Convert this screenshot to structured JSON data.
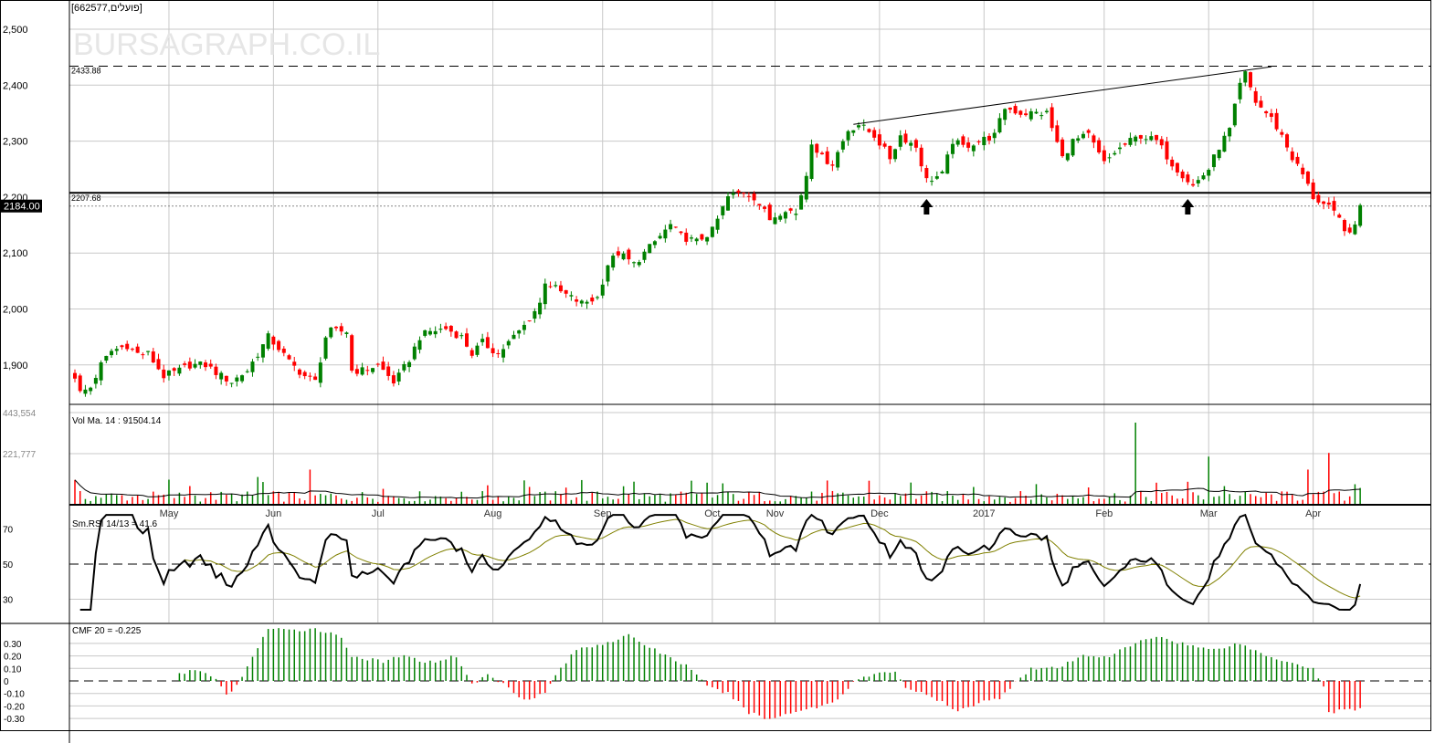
{
  "header": {
    "symbol_label": "[662577,פועלים]",
    "watermark": "BURSAGRAPH.CO.IL"
  },
  "colors": {
    "up": "#008000",
    "down": "#ff0000",
    "grid": "#c8c8c8",
    "signal": "#808000",
    "rsi": "#000000"
  },
  "chart_data": [
    {
      "type": "candlestick",
      "title": "[662577,פועלים]",
      "ylim": [
        1830,
        2550
      ],
      "yticks": [
        1900,
        2000,
        2100,
        2200,
        2300,
        2400,
        2500
      ],
      "ytick_labels": [
        "1,900",
        "2,000",
        "2,100",
        "2,200",
        "2,300",
        "2,400",
        "2,500"
      ],
      "x_months": [
        {
          "label": "May",
          "day": 18
        },
        {
          "label": "Jun",
          "day": 38
        },
        {
          "label": "Jul",
          "day": 58
        },
        {
          "label": "Aug",
          "day": 80
        },
        {
          "label": "Sep",
          "day": 101
        },
        {
          "label": "Oct",
          "day": 122
        },
        {
          "label": "Nov",
          "day": 134
        },
        {
          "label": "Dec",
          "day": 154
        },
        {
          "label": "2017",
          "day": 174
        },
        {
          "label": "Feb",
          "day": 197
        },
        {
          "label": "Mar",
          "day": 217
        },
        {
          "label": "Apr",
          "day": 237
        }
      ],
      "total_days": 247,
      "close_path": [
        [
          0,
          1880
        ],
        [
          1,
          1850
        ],
        [
          3,
          1860
        ],
        [
          5,
          1900
        ],
        [
          7,
          1925
        ],
        [
          10,
          1935
        ],
        [
          12,
          1920
        ],
        [
          14,
          1920
        ],
        [
          17,
          1880
        ],
        [
          20,
          1890
        ],
        [
          22,
          1900
        ],
        [
          25,
          1900
        ],
        [
          28,
          1880
        ],
        [
          30,
          1870
        ],
        [
          33,
          1890
        ],
        [
          35,
          1920
        ],
        [
          37,
          1950
        ],
        [
          39,
          1930
        ],
        [
          41,
          1905
        ],
        [
          44,
          1880
        ],
        [
          46,
          1870
        ],
        [
          48,
          1950
        ],
        [
          49,
          1960
        ],
        [
          52,
          1960
        ],
        [
          53,
          1890
        ],
        [
          55,
          1890
        ],
        [
          58,
          1900
        ],
        [
          61,
          1870
        ],
        [
          62,
          1880
        ],
        [
          64,
          1910
        ],
        [
          66,
          1950
        ],
        [
          68,
          1960
        ],
        [
          71,
          1965
        ],
        [
          74,
          1950
        ],
        [
          76,
          1920
        ],
        [
          78,
          1940
        ],
        [
          81,
          1920
        ],
        [
          83,
          1940
        ],
        [
          86,
          1970
        ],
        [
          89,
          2010
        ],
        [
          90,
          2050
        ],
        [
          93,
          2030
        ],
        [
          95,
          2020
        ],
        [
          97,
          2010
        ],
        [
          100,
          2020
        ],
        [
          102,
          2080
        ],
        [
          104,
          2100
        ],
        [
          107,
          2080
        ],
        [
          109,
          2100
        ],
        [
          112,
          2130
        ],
        [
          114,
          2150
        ],
        [
          116,
          2130
        ],
        [
          119,
          2120
        ],
        [
          122,
          2140
        ],
        [
          123,
          2160
        ],
        [
          125,
          2200
        ],
        [
          128,
          2210
        ],
        [
          130,
          2200
        ],
        [
          133,
          2160
        ],
        [
          136,
          2180
        ],
        [
          138,
          2170
        ],
        [
          140,
          2240
        ],
        [
          141,
          2300
        ],
        [
          143,
          2270
        ],
        [
          145,
          2260
        ],
        [
          148,
          2320
        ],
        [
          150,
          2330
        ],
        [
          153,
          2310
        ],
        [
          156,
          2270
        ],
        [
          158,
          2310
        ],
        [
          161,
          2290
        ],
        [
          163,
          2230
        ],
        [
          166,
          2240
        ],
        [
          168,
          2300
        ],
        [
          170,
          2290
        ],
        [
          173,
          2300
        ],
        [
          176,
          2310
        ],
        [
          178,
          2360
        ],
        [
          181,
          2350
        ],
        [
          183,
          2350
        ],
        [
          186,
          2350
        ],
        [
          189,
          2270
        ],
        [
          191,
          2300
        ],
        [
          194,
          2310
        ],
        [
          197,
          2260
        ],
        [
          199,
          2280
        ],
        [
          202,
          2300
        ],
        [
          204,
          2310
        ],
        [
          207,
          2300
        ],
        [
          210,
          2260
        ],
        [
          212,
          2240
        ],
        [
          214,
          2220
        ],
        [
          217,
          2250
        ],
        [
          219,
          2290
        ],
        [
          221,
          2320
        ],
        [
          223,
          2400
        ],
        [
          224,
          2420
        ],
        [
          226,
          2370
        ],
        [
          229,
          2340
        ],
        [
          231,
          2310
        ],
        [
          233,
          2270
        ],
        [
          235,
          2240
        ],
        [
          237,
          2200
        ],
        [
          240,
          2180
        ],
        [
          242,
          2160
        ],
        [
          244,
          2130
        ],
        [
          245,
          2150
        ],
        [
          246,
          2190
        ]
      ],
      "hlines": [
        {
          "label": "2433.88",
          "value": 2433.88,
          "style": "dashed"
        },
        {
          "label": "2207.68",
          "value": 2207.68,
          "style": "solid"
        }
      ],
      "last_price": {
        "label": "2184.00",
        "value": 2184.0
      },
      "trendline": {
        "from": [
          149,
          2330
        ],
        "to": [
          229,
          2433
        ]
      },
      "arrows_up_days": [
        163,
        213
      ]
    },
    {
      "type": "bar",
      "title": "Vol Ma. 14 : 91504.14",
      "yticks_labels": [
        "443,554",
        "221,777"
      ],
      "yticks": [
        443554,
        221777
      ],
      "ylim": [
        0,
        443554
      ],
      "base_volume": 50000,
      "spikes": [
        [
          45,
          190000
        ],
        [
          35,
          150000
        ],
        [
          203,
          443554
        ],
        [
          217,
          260000
        ],
        [
          240,
          280000
        ],
        [
          236,
          190000
        ],
        [
          118,
          130000
        ],
        [
          160,
          120000
        ]
      ],
      "ma_value": 91504.14
    },
    {
      "type": "line",
      "title": "Sm.RSI 14/13 = 41.6",
      "yticks": [
        30,
        50,
        70
      ],
      "ytick_labels": [
        "30",
        "50",
        "70"
      ],
      "ylim": [
        20,
        80
      ],
      "reference": 50,
      "series": [
        {
          "name": "Sm.RSI 14"
        },
        {
          "name": "Signal 13"
        }
      ]
    },
    {
      "type": "bar",
      "title": "CMF 20 = -0.225",
      "yticks": [
        0.3,
        0.2,
        0.1,
        0,
        -0.1,
        -0.2,
        -0.3
      ],
      "ytick_labels": [
        "0.30",
        "0.20",
        "0.10",
        "0",
        "-0.10",
        "-0.20",
        "-0.30"
      ],
      "ylim": [
        -0.33,
        0.42
      ],
      "path": [
        [
          20,
          0.05
        ],
        [
          23,
          0.1
        ],
        [
          27,
          0.01
        ],
        [
          29,
          -0.12
        ],
        [
          32,
          0.02
        ],
        [
          34,
          0.2
        ],
        [
          37,
          0.42
        ],
        [
          41,
          0.4
        ],
        [
          46,
          0.42
        ],
        [
          51,
          0.35
        ],
        [
          53,
          0.2
        ],
        [
          59,
          0.15
        ],
        [
          62,
          0.2
        ],
        [
          68,
          0.15
        ],
        [
          73,
          0.2
        ],
        [
          75,
          0.05
        ],
        [
          76,
          -0.03
        ],
        [
          79,
          0.05
        ],
        [
          83,
          -0.05
        ],
        [
          86,
          -0.15
        ],
        [
          90,
          -0.1
        ],
        [
          92,
          0.05
        ],
        [
          96,
          0.25
        ],
        [
          101,
          0.3
        ],
        [
          106,
          0.36
        ],
        [
          111,
          0.25
        ],
        [
          118,
          0.1
        ],
        [
          121,
          -0.05
        ],
        [
          125,
          -0.1
        ],
        [
          129,
          -0.25
        ],
        [
          133,
          -0.31
        ],
        [
          137,
          -0.25
        ],
        [
          143,
          -0.2
        ],
        [
          146,
          -0.15
        ],
        [
          149,
          0.0
        ],
        [
          153,
          0.05
        ],
        [
          157,
          0.08
        ],
        [
          159,
          -0.05
        ],
        [
          165,
          -0.15
        ],
        [
          169,
          -0.25
        ],
        [
          174,
          -0.15
        ],
        [
          177,
          -0.15
        ],
        [
          180,
          0.0
        ],
        [
          183,
          0.1
        ],
        [
          188,
          0.1
        ],
        [
          193,
          0.2
        ],
        [
          198,
          0.2
        ],
        [
          203,
          0.3
        ],
        [
          207,
          0.36
        ],
        [
          212,
          0.3
        ],
        [
          217,
          0.25
        ],
        [
          223,
          0.3
        ],
        [
          228,
          0.2
        ],
        [
          233,
          0.15
        ],
        [
          237,
          0.1
        ],
        [
          239,
          -0.05
        ],
        [
          240,
          -0.25
        ],
        [
          246,
          -0.22
        ]
      ]
    }
  ]
}
